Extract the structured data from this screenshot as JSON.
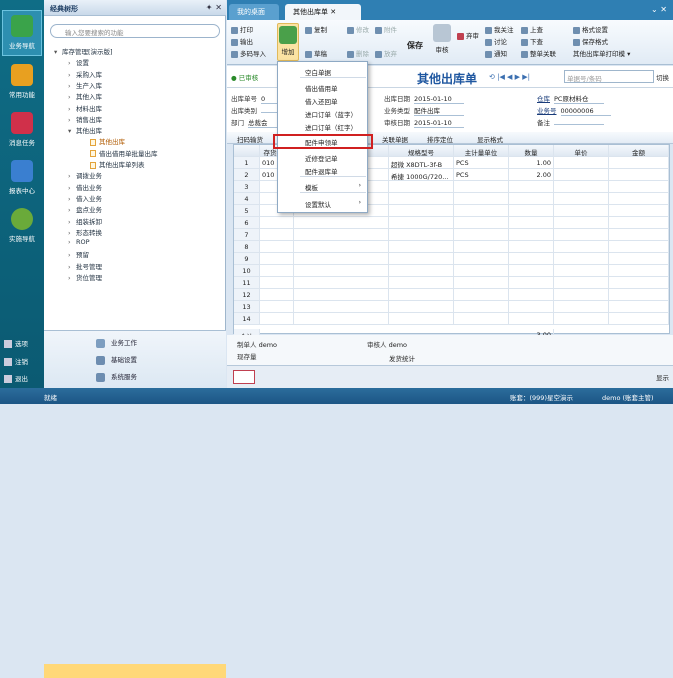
{
  "leftnav": {
    "items": [
      "业务导航",
      "常用功能",
      "消息任务",
      "报表中心",
      "实施导航"
    ],
    "bottom": [
      "选项",
      "注销",
      "退出"
    ]
  },
  "tree": {
    "title": "经典树形",
    "search_placeholder": "输入您要搜索的功能",
    "items": [
      {
        "label": "库存管理[演示版]",
        "arrow": "▾",
        "indent": 0
      },
      {
        "label": "设置",
        "arrow": "›",
        "indent": 1
      },
      {
        "label": "采购入库",
        "arrow": "›",
        "indent": 1
      },
      {
        "label": "生产入库",
        "arrow": "›",
        "indent": 1
      },
      {
        "label": "其他入库",
        "arrow": "›",
        "indent": 1
      },
      {
        "label": "材料出库",
        "arrow": "›",
        "indent": 1
      },
      {
        "label": "销售出库",
        "arrow": "›",
        "indent": 1
      },
      {
        "label": "其他出库",
        "arrow": "▾",
        "indent": 1
      },
      {
        "label": "其他出库",
        "arrow": "",
        "indent": 2,
        "doc": true,
        "selected": true
      },
      {
        "label": "借出借用单批量出库",
        "arrow": "",
        "indent": 2,
        "doc": true
      },
      {
        "label": "其他出库单列表",
        "arrow": "",
        "indent": 2,
        "doc": true
      },
      {
        "label": "调拨业务",
        "arrow": "›",
        "indent": 1
      },
      {
        "label": "借出业务",
        "arrow": "›",
        "indent": 1
      },
      {
        "label": "借入业务",
        "arrow": "›",
        "indent": 1
      },
      {
        "label": "盘点业务",
        "arrow": "›",
        "indent": 1
      },
      {
        "label": "组装拆卸",
        "arrow": "›",
        "indent": 1
      },
      {
        "label": "形态转换",
        "arrow": "›",
        "indent": 1
      },
      {
        "label": "ROP",
        "arrow": "›",
        "indent": 1
      },
      {
        "label": "预留",
        "arrow": "›",
        "indent": 1
      },
      {
        "label": "批号管理",
        "arrow": "›",
        "indent": 1
      },
      {
        "label": "货位管理",
        "arrow": "›",
        "indent": 1
      }
    ],
    "bottom": [
      "业务工作",
      "基础设置",
      "系统服务"
    ]
  },
  "tabs": [
    "我的桌面",
    "其他出库单"
  ],
  "toolbar": {
    "print": "打印",
    "export": "输出",
    "import": "多码导入",
    "add": "增加",
    "copy": "复制",
    "modify": "修改",
    "attach": "附件",
    "draft": "草稿",
    "delete": "删除",
    "abandon": "放弃",
    "save": "保存",
    "audit": "审核",
    "relay": "弃审",
    "notify": "通知",
    "discuss": "讨论",
    "link": "我关注",
    "firstrec": "上查",
    "nextrec": "下查",
    "format_set": "格式设置",
    "save_format": "保存格式",
    "whole_link": "整单关联",
    "print_template": "其他出库单打印模"
  },
  "docbar": {
    "status": "已审核",
    "title": "其他出库单",
    "search_placeholder": "单据号/条码",
    "switch": "切换"
  },
  "form": {
    "fields": [
      {
        "label": "出库单号",
        "value": "0"
      },
      {
        "label": "出库日期",
        "value": "2015-01-10"
      },
      {
        "label": "仓库",
        "value": "PC原材料仓",
        "link": true
      },
      {
        "label": "出库类别",
        "value": ""
      },
      {
        "label": "业务类型",
        "value": "配件出库"
      },
      {
        "label": "业务号",
        "value": "00000006",
        "link": true
      },
      {
        "label": "部门",
        "value": "总裁会"
      },
      {
        "label": "审核日期",
        "value": "2015-01-10"
      },
      {
        "label": "备注",
        "value": ""
      }
    ]
  },
  "gridtb": {
    "items": [
      "扫码输货",
      "关联单据",
      "排序定位",
      "显示格式"
    ]
  },
  "grid": {
    "headers": [
      "",
      "存货编码",
      "存货名称",
      "规格型号",
      "主计量单位",
      "数量",
      "单价",
      "金额"
    ],
    "rows": [
      {
        "no": "1",
        "code": "010",
        "name": "",
        "spec": "超微 X8DTL-3f-B",
        "unit": "PCS",
        "qty": "1.00",
        "price": "",
        "amount": ""
      },
      {
        "no": "2",
        "code": "010",
        "name": "",
        "spec": "希捷 1000G/720...",
        "unit": "PCS",
        "qty": "2.00",
        "price": "",
        "amount": ""
      }
    ],
    "empty_rows": [
      "3",
      "4",
      "5",
      "6",
      "7",
      "8",
      "9",
      "10",
      "11",
      "12",
      "13",
      "14"
    ],
    "total_label": "合计",
    "total_qty": "3.00"
  },
  "footer": {
    "maker_label": "制单人",
    "maker": "demo",
    "auditor_label": "审核人",
    "auditor": "demo",
    "stock_label": "现存量",
    "shipment": "发货统计"
  },
  "bottompanel": {
    "show": "显示"
  },
  "dropdown": {
    "items": [
      "空白单据",
      "借出借用单",
      "借入还回单",
      "进口订单（蓝字）",
      "进口订单（红字）",
      "配件申领单",
      "近修登记单",
      "配件退库单",
      "模板",
      "设置默认"
    ]
  },
  "statusbar": {
    "ready": "就绪",
    "account": "账套：(999)星空演示",
    "user": "demo (账套主管)"
  }
}
